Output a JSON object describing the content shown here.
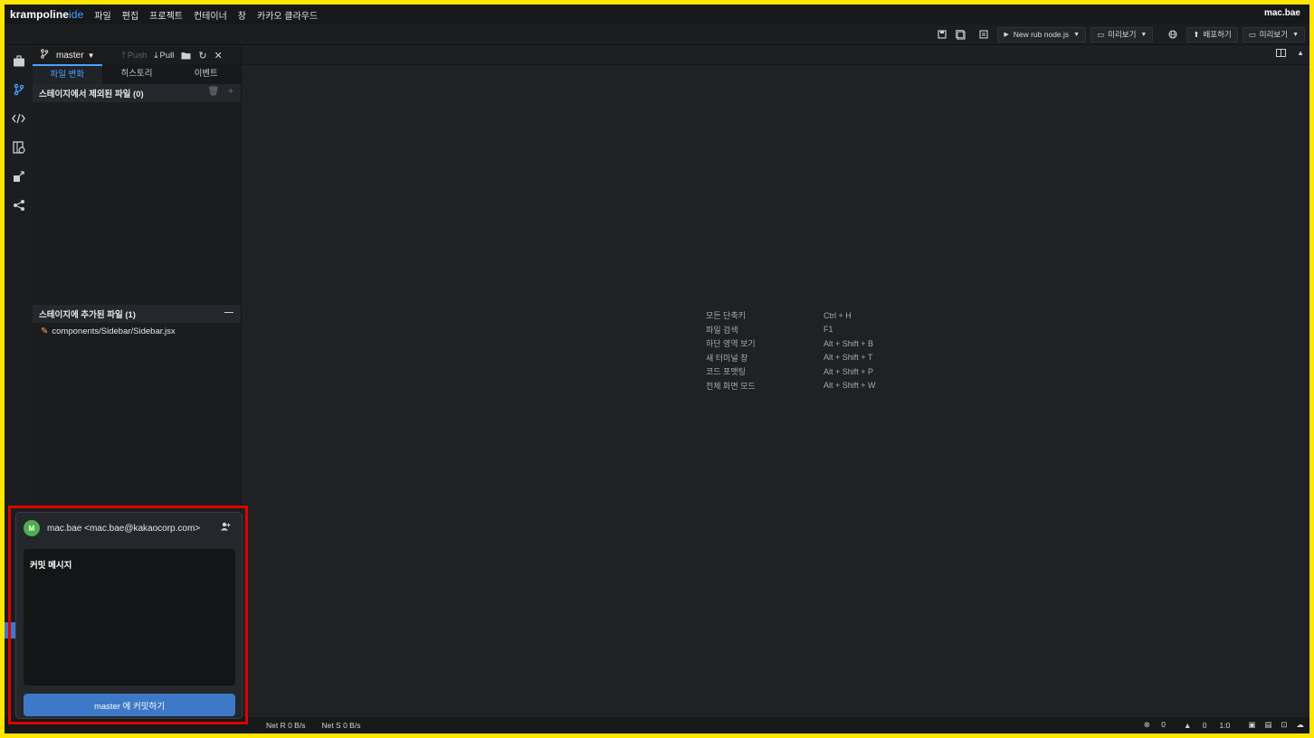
{
  "menubar": {
    "logo_main": "krampoline",
    "logo_ide": "ide",
    "items": [
      "파일",
      "편집",
      "프로젝트",
      "컨테이너",
      "창",
      "카카오 클라우드"
    ],
    "user": "mac.bae"
  },
  "toolbar": {
    "run_label": "New rub node.js",
    "preview_label_1": "미리보기",
    "deploy_label": "배포하기",
    "preview_label_2": "미리보기"
  },
  "panel": {
    "branch": "master",
    "push": "Push",
    "pull": "Pull",
    "tabs": [
      "파일 변화",
      "히스토리",
      "이벤트"
    ],
    "unstaged_header": "스테이지에서 제외된 파일 (0)",
    "staged_header": "스테이지에 추가된 파일 (1)",
    "staged_files": [
      "components/Sidebar/Sidebar.jsx"
    ]
  },
  "shortcuts": [
    {
      "name": "모든 단축키",
      "key": "Ctrl + H"
    },
    {
      "name": "파일 검색",
      "key": "F1"
    },
    {
      "name": "하단 영역 보기",
      "key": "Alt + Shift + B"
    },
    {
      "name": "새 터미널 창",
      "key": "Alt + Shift + T"
    },
    {
      "name": "코드 포맷팅",
      "key": "Alt + Shift + P"
    },
    {
      "name": "전체 화면 모드",
      "key": "Alt + Shift + W"
    }
  ],
  "commit": {
    "avatar_letter": "M",
    "author": "mac.bae <mac.bae@kakaocorp.com>",
    "placeholder": "커밋 메시지",
    "button": "master 에 커밋하기"
  },
  "statusbar": {
    "net_r": "Net R 0 B/s",
    "net_s": "Net S 0 B/s",
    "errors": "0",
    "warnings": "0",
    "position": "1:0"
  },
  "colors": {
    "accent": "#4aa3ff",
    "commit_button": "#3d79c6",
    "highlight_border": "#e00000",
    "frame_border": "#ffe600"
  }
}
